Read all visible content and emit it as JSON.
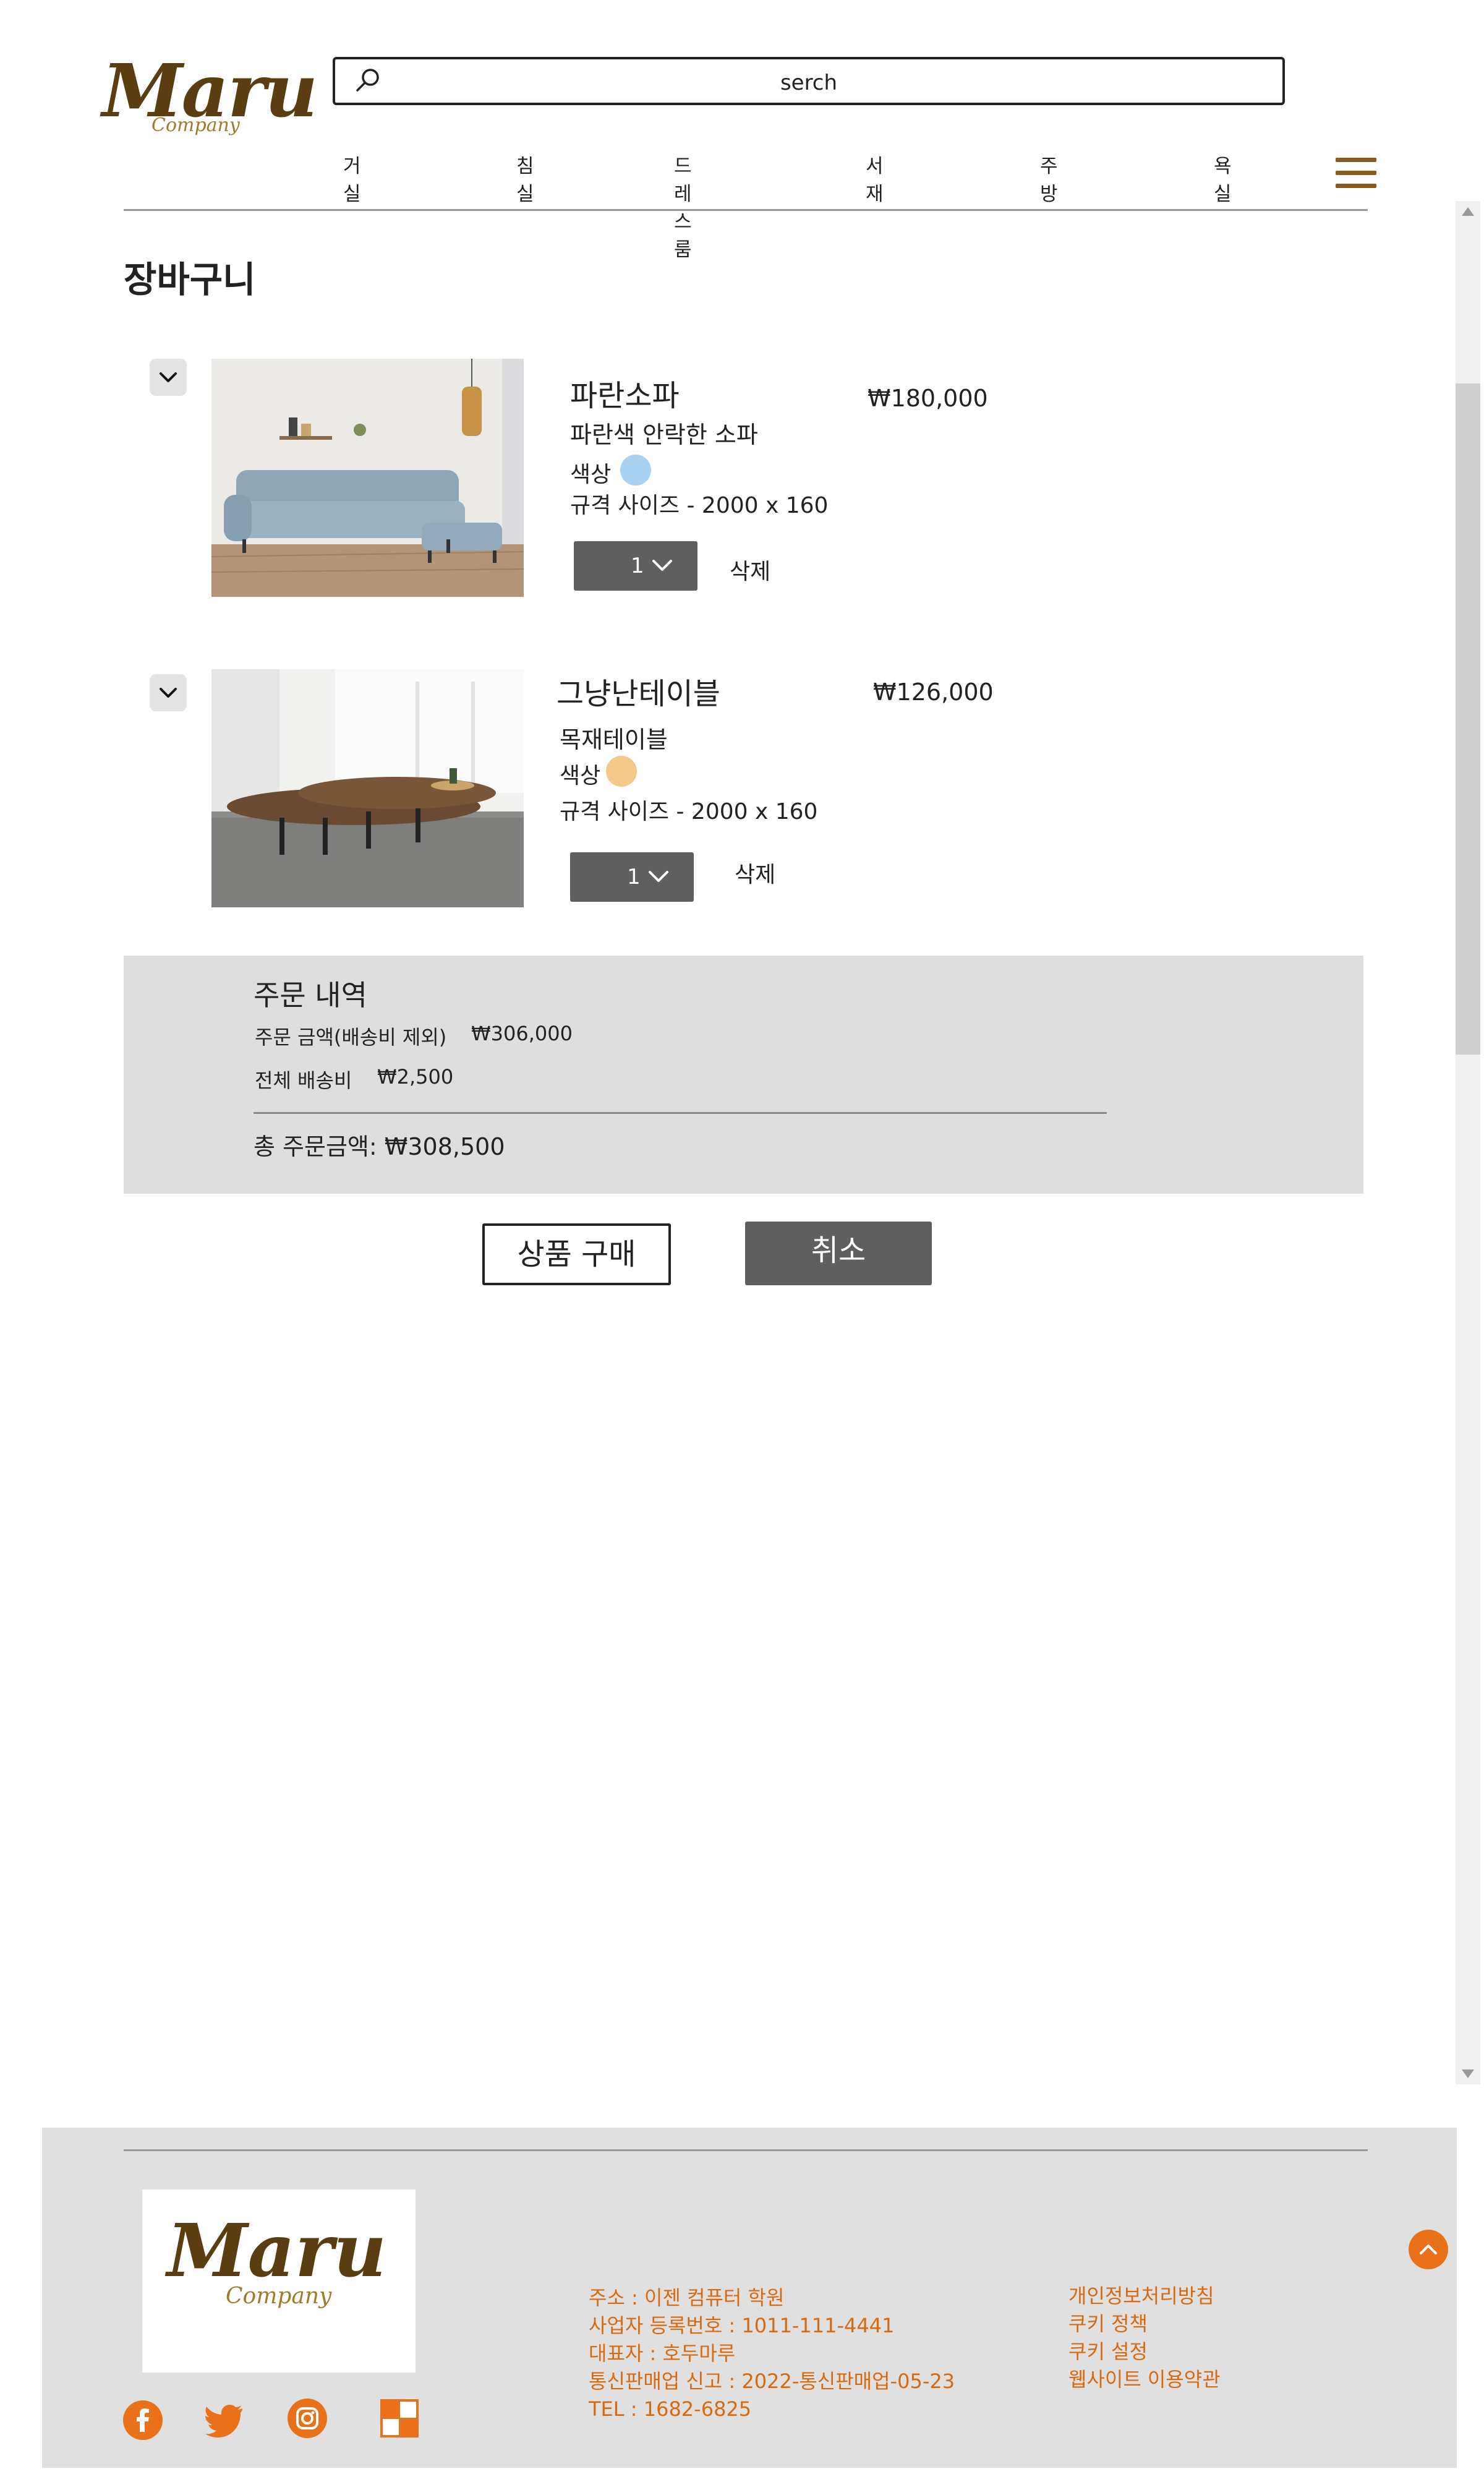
{
  "brand": {
    "name": "Maru",
    "sub": "Company"
  },
  "search": {
    "placeholder": "serch"
  },
  "nav": {
    "items": [
      "거실",
      "침실",
      "드레스룸",
      "서재",
      "주방",
      "욕실"
    ]
  },
  "cart": {
    "title": "장바구니",
    "color_label": "색상",
    "delete_label": "삭제",
    "items": [
      {
        "name": "파란소파",
        "desc": "파란색 안락한 소파",
        "color": "#a9d1f2",
        "size": "규격 사이즈 - 2000 x 160",
        "price": "₩180,000",
        "qty": "1"
      },
      {
        "name": "그냥난테이블",
        "desc": "목재테이블",
        "color": "#f3c98a",
        "size": "규격 사이즈 - 2000 x 160",
        "price": "₩126,000",
        "qty": "1"
      }
    ]
  },
  "order": {
    "title": "주문 내역",
    "subtotal_label": "주문 금액(배송비 제외)",
    "subtotal_value": "₩306,000",
    "shipping_label": "전체 배송비",
    "shipping_value": "₩2,500",
    "total_label": "총 주문금액:",
    "total_value": "₩308,500"
  },
  "buttons": {
    "buy": "상품 구매",
    "cancel": "취소"
  },
  "footer": {
    "address_lines": [
      "주소 : 이젠 컴퓨터 학원",
      "사업자 등록번호 : 1011-111-4441",
      "대표자 : 호두마루",
      "통신판매업 신고 : 2022-통신판매업-05-23",
      "TEL : 1682-6825"
    ],
    "policies": [
      "개인정보처리방침",
      "쿠키 정책",
      "쿠키 설정",
      "웹사이트 이용약관"
    ]
  },
  "colors": {
    "accent": "#e8711a",
    "menu": "#8b5a1e",
    "dark_button": "#5f5f5f",
    "footer_text": "#d9690f"
  }
}
